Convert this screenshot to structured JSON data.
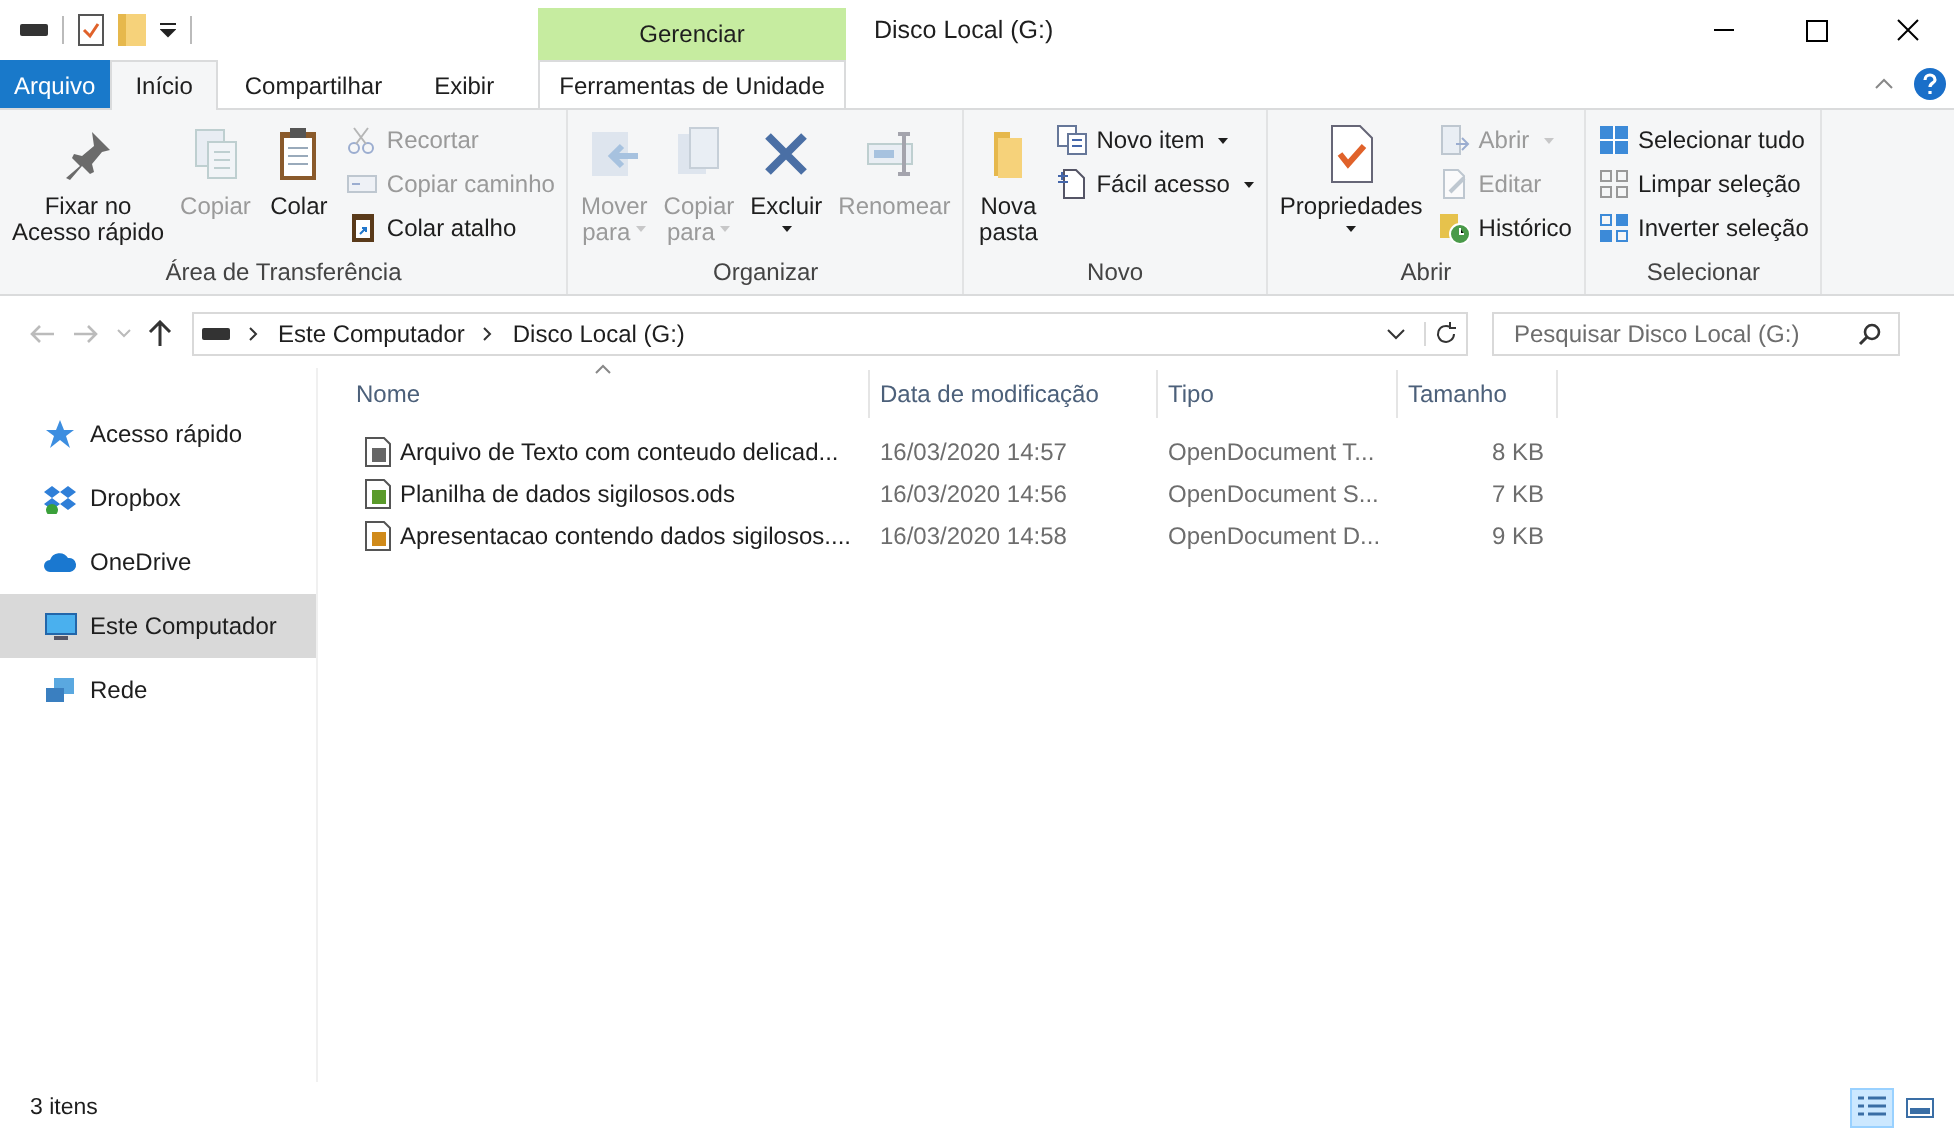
{
  "window": {
    "title": "Disco Local (G:)",
    "context_group": "Gerenciar"
  },
  "ribbon_tabs": [
    {
      "label": "Arquivo",
      "kind": "file",
      "selected": false
    },
    {
      "label": "Início",
      "kind": "tab",
      "selected": true
    },
    {
      "label": "Compartilhar",
      "kind": "tab",
      "selected": false
    },
    {
      "label": "Exibir",
      "kind": "tab",
      "selected": false
    },
    {
      "label": "Ferramentas de Unidade",
      "kind": "context",
      "selected": false
    }
  ],
  "ribbon_groups": [
    {
      "label": "Área de Transferência",
      "items": [
        {
          "kind": "large",
          "lines": [
            "Fixar no",
            "Acesso rápido"
          ],
          "disabled": false,
          "dropdown": false
        },
        {
          "kind": "large",
          "lines": [
            "Copiar"
          ],
          "disabled": true,
          "dropdown": false
        },
        {
          "kind": "large",
          "lines": [
            "Colar"
          ],
          "disabled": false,
          "dropdown": false
        },
        {
          "kind": "small",
          "lines": [
            "Recortar"
          ],
          "disabled": true,
          "dropdown": false
        },
        {
          "kind": "small",
          "lines": [
            "Copiar caminho"
          ],
          "disabled": true,
          "dropdown": false
        },
        {
          "kind": "small",
          "lines": [
            "Colar atalho"
          ],
          "disabled": false,
          "dropdown": false
        }
      ]
    },
    {
      "label": "Organizar",
      "items": [
        {
          "kind": "large",
          "lines": [
            "Mover",
            "para"
          ],
          "disabled": true,
          "dropdown": true
        },
        {
          "kind": "large",
          "lines": [
            "Copiar",
            "para"
          ],
          "disabled": true,
          "dropdown": true
        },
        {
          "kind": "large",
          "lines": [
            "Excluir"
          ],
          "disabled": false,
          "dropdown": true
        },
        {
          "kind": "large",
          "lines": [
            "Renomear"
          ],
          "disabled": true,
          "dropdown": false
        }
      ]
    },
    {
      "label": "Novo",
      "items": [
        {
          "kind": "large",
          "lines": [
            "Nova",
            "pasta"
          ],
          "disabled": false,
          "dropdown": false
        },
        {
          "kind": "small",
          "lines": [
            "Novo item"
          ],
          "disabled": false,
          "dropdown": true
        },
        {
          "kind": "small",
          "lines": [
            "Fácil acesso"
          ],
          "disabled": false,
          "dropdown": true
        }
      ]
    },
    {
      "label": "Abrir",
      "items": [
        {
          "kind": "large",
          "lines": [
            "Propriedades"
          ],
          "disabled": false,
          "dropdown": true
        },
        {
          "kind": "small",
          "lines": [
            "Abrir"
          ],
          "disabled": true,
          "dropdown": true
        },
        {
          "kind": "small",
          "lines": [
            "Editar"
          ],
          "disabled": true,
          "dropdown": false
        },
        {
          "kind": "small",
          "lines": [
            "Histórico"
          ],
          "disabled": false,
          "dropdown": false
        }
      ]
    },
    {
      "label": "Selecionar",
      "items": [
        {
          "kind": "small",
          "lines": [
            "Selecionar tudo"
          ],
          "disabled": false,
          "dropdown": false
        },
        {
          "kind": "small",
          "lines": [
            "Limpar seleção"
          ],
          "disabled": false,
          "dropdown": false
        },
        {
          "kind": "small",
          "lines": [
            "Inverter seleção"
          ],
          "disabled": false,
          "dropdown": false
        }
      ]
    }
  ],
  "address": {
    "crumbs": [
      "Este Computador",
      "Disco Local (G:)"
    ]
  },
  "search": {
    "placeholder": "Pesquisar Disco Local (G:)"
  },
  "nav": [
    {
      "label": "Acesso rápido",
      "selected": false
    },
    {
      "label": "Dropbox",
      "selected": false
    },
    {
      "label": "OneDrive",
      "selected": false
    },
    {
      "label": "Este Computador",
      "selected": true
    },
    {
      "label": "Rede",
      "selected": false
    }
  ],
  "columns": [
    {
      "label": "Nome",
      "sorted": true
    },
    {
      "label": "Data de modificação",
      "sorted": false
    },
    {
      "label": "Tipo",
      "sorted": false
    },
    {
      "label": "Tamanho",
      "sorted": false
    }
  ],
  "rows": [
    {
      "kind": "text",
      "name": "Arquivo de Texto com conteudo delicad...",
      "date": "16/03/2020 14:57",
      "type": "OpenDocument T...",
      "size": "8 KB"
    },
    {
      "kind": "spreadsheet",
      "name": "Planilha de dados sigilosos.ods",
      "date": "16/03/2020 14:56",
      "type": "OpenDocument S...",
      "size": "7 KB"
    },
    {
      "kind": "presentation",
      "name": "Apresentacao contendo dados sigilosos....",
      "date": "16/03/2020 14:58",
      "type": "OpenDocument D...",
      "size": "9 KB"
    }
  ],
  "status_bar": {
    "count": "3 itens"
  },
  "view_buttons": [
    {
      "selected": true
    },
    {
      "selected": false
    }
  ]
}
